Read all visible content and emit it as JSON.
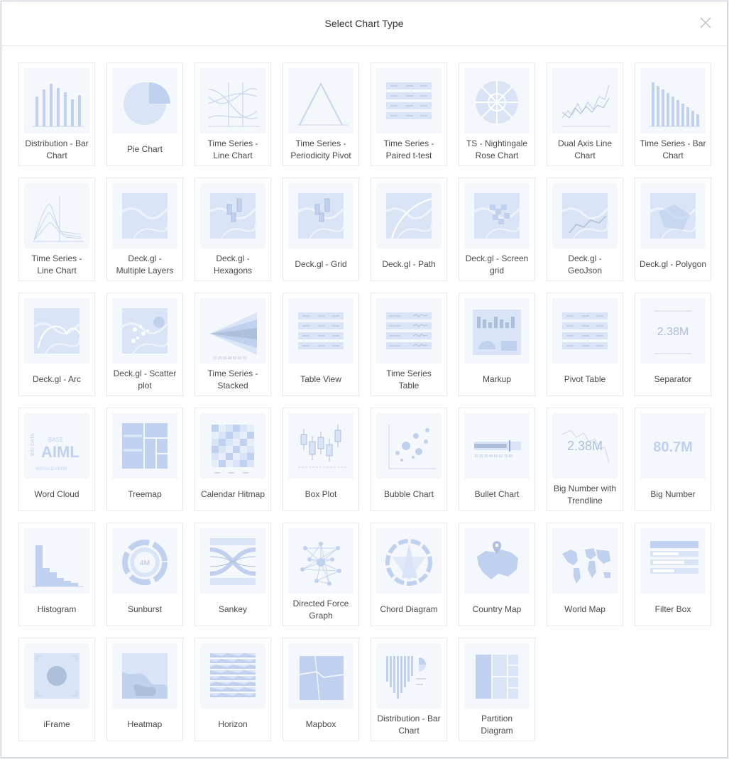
{
  "modal": {
    "title": "Select Chart Type",
    "close_label": "×"
  },
  "colors": {
    "accent": "#4f8ff7",
    "thumb_bg": "#f4f7fb",
    "stroke": "#c7d6ef",
    "fill": "#d9e5f6"
  },
  "chart_types": [
    {
      "label": "Distribution - Bar\nChart",
      "icon": "bars-icon"
    },
    {
      "label": "Pie Chart",
      "icon": "pie-icon"
    },
    {
      "label": "Time Series -\nLine Chart",
      "icon": "lines-icon"
    },
    {
      "label": "Time Series -\nPeriodicity Pivot",
      "icon": "peak-icon"
    },
    {
      "label": "Time Series -\nPaired t-test",
      "icon": "table-rows-icon"
    },
    {
      "label": "TS - Nightingale\nRose Chart",
      "icon": "rose-icon"
    },
    {
      "label": "Dual Axis Line\nChart",
      "icon": "dual-line-icon"
    },
    {
      "label": "Time Series - Bar\nChart",
      "icon": "desc-bars-icon"
    },
    {
      "label": "Time Series -\nLine Chart",
      "icon": "area-lines-icon"
    },
    {
      "label": "Deck.gl -\nMultiple Layers",
      "icon": "map-icon"
    },
    {
      "label": "Deck.gl -\nHexagons",
      "icon": "map-candles-icon"
    },
    {
      "label": "Deck.gl - Grid",
      "icon": "map-candles-icon"
    },
    {
      "label": "Deck.gl - Path",
      "icon": "map-path-icon"
    },
    {
      "label": "Deck.gl - Screen\ngrid",
      "icon": "map-checker-icon"
    },
    {
      "label": "Deck.gl -\nGeoJson",
      "icon": "map-geo-icon"
    },
    {
      "label": "Deck.gl - Polygon",
      "icon": "map-polygon-icon"
    },
    {
      "label": "Deck.gl - Arc",
      "icon": "map-arc-icon"
    },
    {
      "label": "Deck.gl - Scatter\nplot",
      "icon": "map-scatter-icon"
    },
    {
      "label": "Time Series -\nStacked",
      "icon": "stacked-icon"
    },
    {
      "label": "Table View",
      "icon": "table-icon"
    },
    {
      "label": "Time Series\nTable",
      "icon": "ts-table-icon"
    },
    {
      "label": "Markup",
      "icon": "dashboard-icon"
    },
    {
      "label": "Pivot Table",
      "icon": "pivot-icon"
    },
    {
      "label": "Separator",
      "icon": "separator-icon"
    },
    {
      "label": "Word Cloud",
      "icon": "wordcloud-icon"
    },
    {
      "label": "Treemap",
      "icon": "treemap-icon"
    },
    {
      "label": "Calendar Hitmap",
      "icon": "calendar-icon"
    },
    {
      "label": "Box Plot",
      "icon": "boxplot-icon"
    },
    {
      "label": "Bubble Chart",
      "icon": "bubble-icon"
    },
    {
      "label": "Bullet Chart",
      "icon": "bullet-icon"
    },
    {
      "label": "Big Number with\nTrendline",
      "icon": "bignumber-trend-icon"
    },
    {
      "label": "Big Number",
      "icon": "bignumber-icon"
    },
    {
      "label": "Histogram",
      "icon": "histogram-icon"
    },
    {
      "label": "Sunburst",
      "icon": "sunburst-icon"
    },
    {
      "label": "Sankey",
      "icon": "sankey-icon"
    },
    {
      "label": "Directed Force\nGraph",
      "icon": "force-graph-icon"
    },
    {
      "label": "Chord Diagram",
      "icon": "chord-icon"
    },
    {
      "label": "Country Map",
      "icon": "country-map-icon"
    },
    {
      "label": "World Map",
      "icon": "world-map-icon"
    },
    {
      "label": "Filter Box",
      "icon": "filter-box-icon"
    },
    {
      "label": "iFrame",
      "icon": "iframe-icon"
    },
    {
      "label": "Heatmap",
      "icon": "heatmap-icon"
    },
    {
      "label": "Horizon",
      "icon": "horizon-icon"
    },
    {
      "label": "Mapbox",
      "icon": "mapbox-icon"
    },
    {
      "label": "Distribution - Bar\nChart",
      "icon": "distribution-icon"
    },
    {
      "label": "Partition\nDiagram",
      "icon": "partition-icon"
    }
  ],
  "thumb_text": {
    "separator_value": "2.38M",
    "trend_value": "2.38M",
    "big_number_value": "80.7M",
    "sunburst_value": "4M",
    "wordcloud_main": "AIML",
    "wordcloud_a": "BIG DATA",
    "wordcloud_b": "BASE",
    "wordcloud_c": "VISUALIZATION",
    "iframe_glyph": "</>"
  }
}
